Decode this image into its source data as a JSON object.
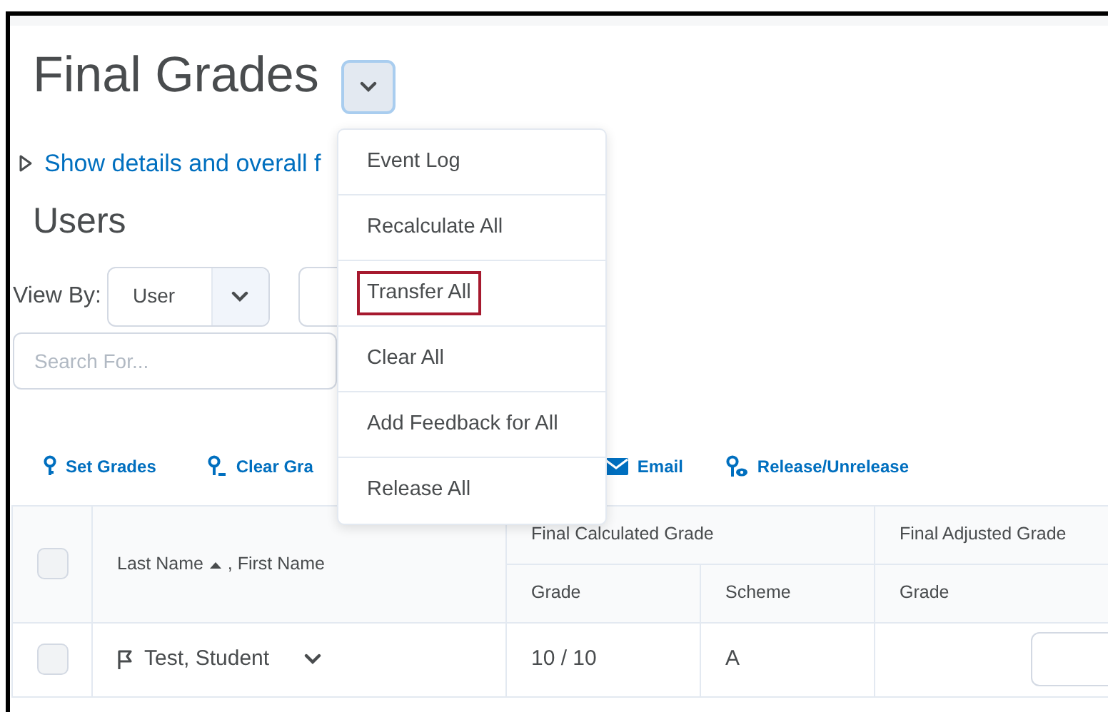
{
  "page": {
    "title": "Final Grades",
    "details_link": "Show details and overall f",
    "section_title": "Users"
  },
  "view_by": {
    "label": "View By:",
    "value": "User"
  },
  "search": {
    "placeholder": "Search For..."
  },
  "actions": [
    {
      "label": "Set Grades",
      "kind": "set"
    },
    {
      "label": "Clear Gra",
      "kind": "clear"
    },
    {
      "label": "Email",
      "kind": "email"
    },
    {
      "label": "Release/Unrelease",
      "kind": "release"
    }
  ],
  "menu": {
    "expanded": true,
    "items": [
      {
        "label": "Event Log",
        "highlighted": false
      },
      {
        "label": "Recalculate All",
        "highlighted": false
      },
      {
        "label": "Transfer All",
        "highlighted": true
      },
      {
        "label": "Clear All",
        "highlighted": false
      },
      {
        "label": "Add Feedback for All",
        "highlighted": false
      },
      {
        "label": "Release All",
        "highlighted": false
      }
    ]
  },
  "table": {
    "select_all": {
      "checked": false
    },
    "name_column": {
      "last": "Last Name",
      "first": ", First Name"
    },
    "groups": [
      {
        "label": "Final Calculated Grade",
        "columns": [
          "Grade",
          "Scheme"
        ]
      },
      {
        "label": "Final Adjusted Grade",
        "columns": [
          "Grade"
        ]
      }
    ],
    "rows": [
      {
        "checked": false,
        "name": "Test, Student",
        "grade": "10 / 10",
        "scheme": "A"
      }
    ]
  }
}
